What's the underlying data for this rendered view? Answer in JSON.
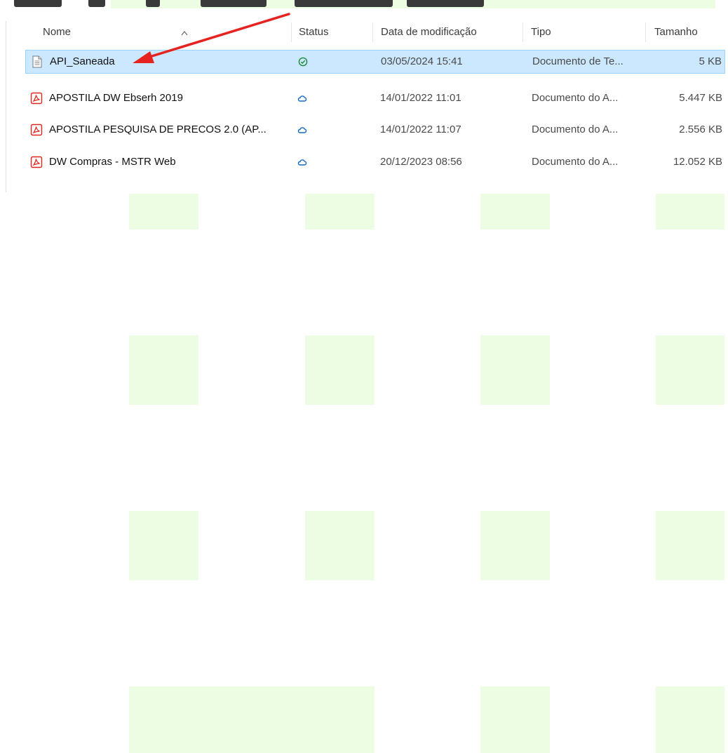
{
  "explorer": {
    "columns": {
      "name": "Nome",
      "status": "Status",
      "date": "Data de modificação",
      "type": "Tipo",
      "size": "Tamanho"
    },
    "files": [
      {
        "name": "API_Saneada",
        "icon": "text-document-icon",
        "status": "available-offline-check-icon",
        "date": "03/05/2024 15:41",
        "type": "Documento de Te...",
        "size": "5 KB",
        "selected": true
      },
      {
        "name": "APOSTILA DW Ebserh 2019",
        "icon": "pdf-document-icon",
        "status": "cloud-only-icon",
        "date": "14/01/2022 11:01",
        "type": "Documento do A...",
        "size": "5.447 KB",
        "selected": false
      },
      {
        "name": "APOSTILA PESQUISA DE PRECOS 2.0 (AP...",
        "icon": "pdf-document-icon",
        "status": "cloud-only-icon",
        "date": "14/01/2022 11:07",
        "type": "Documento do A...",
        "size": "2.556 KB",
        "selected": false
      },
      {
        "name": "DW Compras - MSTR Web",
        "icon": "pdf-document-icon",
        "status": "cloud-only-icon",
        "date": "20/12/2023 08:56",
        "type": "Documento do A...",
        "size": "12.052 KB",
        "selected": false
      }
    ]
  },
  "colors": {
    "selection": "#cce8ff",
    "selection_border": "#99d1ff",
    "annotation_arrow": "#e52420",
    "pdf_red": "#e0261c",
    "check_green": "#1b8a3a",
    "cloud_blue": "#1668c4",
    "background_tile": "#edfde4"
  }
}
